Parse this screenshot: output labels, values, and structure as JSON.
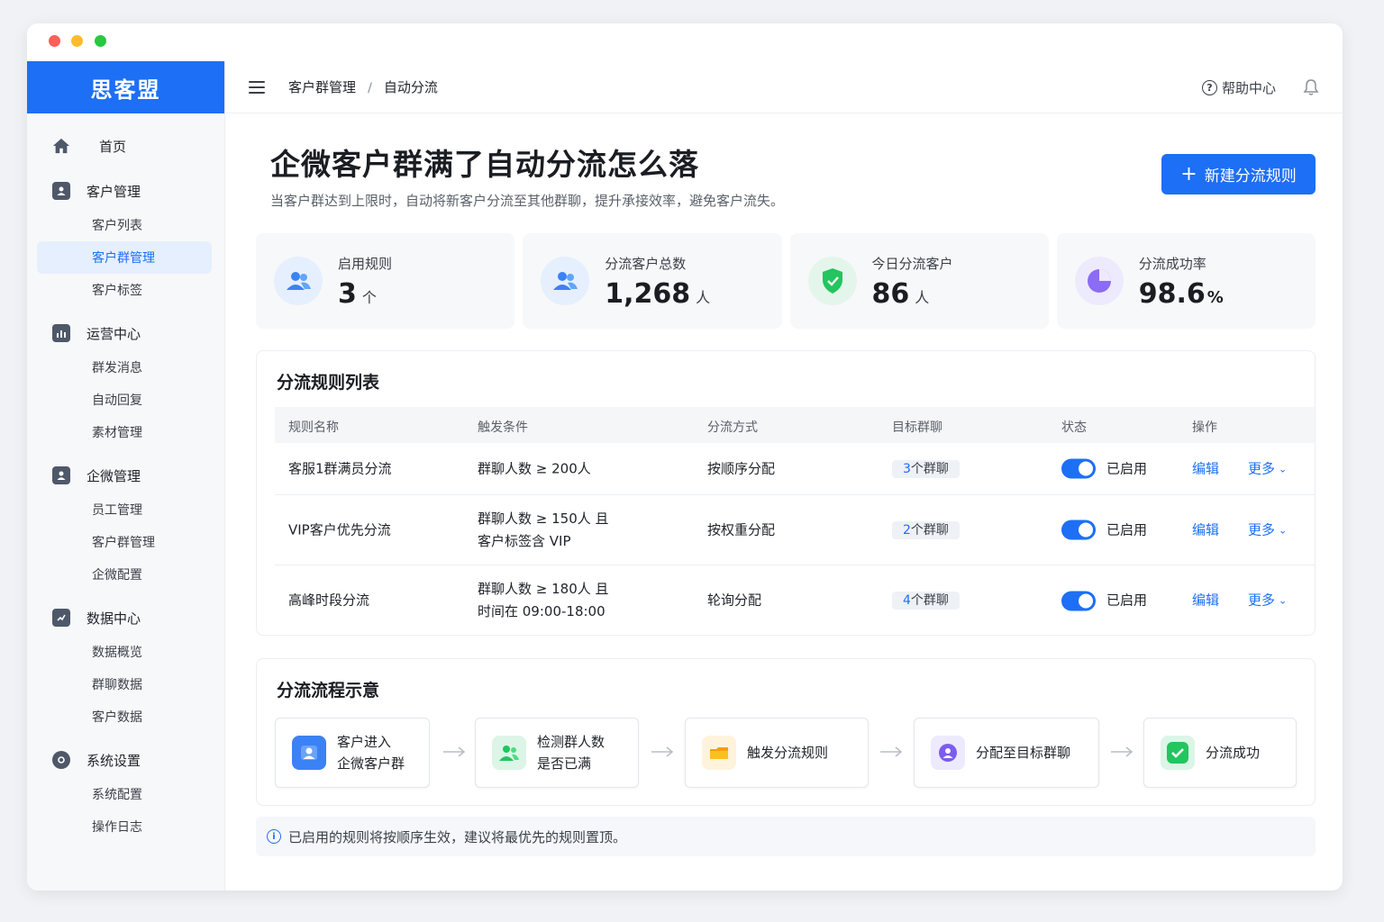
{
  "brand": "思客盟",
  "sidebar": {
    "home": "首页",
    "groups": [
      {
        "label": "客户管理",
        "icon": "user-card-icon",
        "items": [
          "客户列表",
          "客户群管理",
          "客户标签"
        ],
        "active": 1
      },
      {
        "label": "运营中心",
        "icon": "chart-icon",
        "items": [
          "群发消息",
          "自动回复",
          "素材管理"
        ]
      },
      {
        "label": "企微管理",
        "icon": "user-card-icon",
        "items": [
          "员工管理",
          "客户群管理",
          "企微配置"
        ]
      },
      {
        "label": "数据中心",
        "icon": "data-icon",
        "items": [
          "数据概览",
          "群聊数据",
          "客户数据"
        ]
      },
      {
        "label": "系统设置",
        "icon": "gear-icon",
        "items": [
          "系统配置",
          "操作日志"
        ]
      }
    ]
  },
  "topbar": {
    "breadcrumb": [
      "客户群管理",
      "自动分流"
    ],
    "breadcrumb_sep": "/",
    "help": "帮助中心"
  },
  "page": {
    "title": "企微客户群满了自动分流怎么落",
    "subtitle": "当客户群达到上限时，自动将新客户分流至其他群聊，提升承接效率，避免客户流失。",
    "new_button": "新建分流规则"
  },
  "stats": [
    {
      "label": "启用规则",
      "value": "3",
      "unit": "个",
      "color": "#e6effd",
      "fg": "#1d6ff5"
    },
    {
      "label": "分流客户总数",
      "value": "1,268",
      "unit": "人",
      "color": "#e6effd",
      "fg": "#1d6ff5"
    },
    {
      "label": "今日分流客户",
      "value": "86",
      "unit": "人",
      "color": "#e4f6ec",
      "fg": "#19b35e"
    },
    {
      "label": "分流成功率",
      "value": "98.6",
      "unit": "%",
      "color": "#eeeafd",
      "fg": "#7b5cf0"
    }
  ],
  "rules": {
    "title": "分流规则列表",
    "headers": [
      "规则名称",
      "触发条件",
      "分流方式",
      "目标群聊",
      "状态",
      "操作"
    ],
    "rows": [
      {
        "name": "客服1群满员分流",
        "cond1": "群聊人数 ≥ 200人",
        "cond2": "",
        "method": "按顺序分配",
        "target_n": "3",
        "target_s": "个群聊",
        "status": "已启用",
        "edit": "编辑",
        "more": "更多"
      },
      {
        "name": "VIP客户优先分流",
        "cond1": "群聊人数 ≥ 150人 且",
        "cond2": "客户标签含 VIP",
        "method": "按权重分配",
        "target_n": "2",
        "target_s": "个群聊",
        "status": "已启用",
        "edit": "编辑",
        "more": "更多"
      },
      {
        "name": "高峰时段分流",
        "cond1": "群聊人数 ≥ 180人 且",
        "cond2": "时间在 09:00-18:00",
        "method": "轮询分配",
        "target_n": "4",
        "target_s": "个群聊",
        "status": "已启用",
        "edit": "编辑",
        "more": "更多"
      }
    ]
  },
  "flow": {
    "title": "分流流程示意",
    "steps": [
      {
        "line1": "客户进入",
        "line2": "企微客户群"
      },
      {
        "line1": "检测群人数",
        "line2": "是否已满"
      },
      {
        "line1": "触发分流规则",
        "line2": ""
      },
      {
        "line1": "分配至目标群聊",
        "line2": ""
      },
      {
        "line1": "分流成功",
        "line2": ""
      }
    ]
  },
  "notice": "已启用的规则将按顺序生效，建议将最优先的规则置顶。"
}
